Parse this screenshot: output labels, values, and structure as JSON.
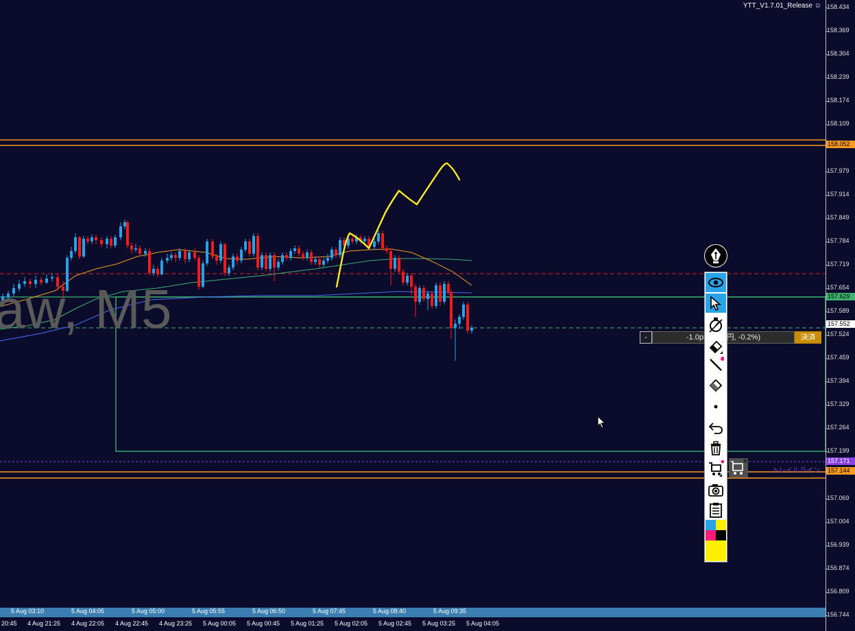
{
  "window": {
    "version_label": "YTT_V1.7.01_Release",
    "watermark": "aw, M5"
  },
  "price_axis": {
    "ticks": [
      "158.434",
      "158.369",
      "158.304",
      "158.239",
      "158.174",
      "158.109",
      "158.052",
      "157.979",
      "157.914",
      "157.849",
      "157.784",
      "157.719",
      "157.654",
      "157.629",
      "157.589",
      "157.552",
      "157.524",
      "157.459",
      "157.394",
      "157.329",
      "157.264",
      "157.199",
      "157.171",
      "157.144",
      "157.069",
      "157.004",
      "156.939",
      "156.874",
      "156.809",
      "156.744"
    ],
    "tags": {
      "upper_line": "158.052",
      "green_line": "157.629",
      "bid": "157.552",
      "trail": "157.171",
      "lower_line": "157.144"
    }
  },
  "time_axis": {
    "upper": [
      "5 Aug 03:10",
      "5 Aug 04:05",
      "5 Aug 05:00",
      "5 Aug 05:55",
      "5 Aug 06:50",
      "5 Aug 07:45",
      "5 Aug 08:40",
      "5 Aug 09:35"
    ],
    "lower": [
      "20:45",
      "4 Aug 21:25",
      "4 Aug 22:05",
      "4 Aug 22:45",
      "4 Aug 23:25",
      "5 Aug 00:05",
      "5 Aug 00:45",
      "5 Aug 01:25",
      "5 Aug 02:05",
      "5 Aug 02:45",
      "5 Aug 03:25",
      "5 Aug 04:05"
    ]
  },
  "position_panel": {
    "minus_label": "-",
    "info_text": "-1.0pips(-84円, -0.2%)",
    "close_label": "決済"
  },
  "trail_label": "トレイルライン",
  "toolbar": {
    "items": [
      "pen-logo",
      "eye",
      "pointer",
      "stopwatch",
      "eraser",
      "line",
      "eraser-2",
      "dot",
      "undo",
      "trash",
      "shopping-cart",
      "camera",
      "clipboard",
      "palette"
    ]
  },
  "colors": {
    "background": "#0b0b2c",
    "bull": "#29a3e8",
    "bear": "#ff1a1a",
    "orange_line": "#ff9a1f",
    "green_line": "#3cb371",
    "yellow_drawing": "#ffee22",
    "trail": "#8a40e0",
    "time_bar": "#3b7fb2"
  }
}
